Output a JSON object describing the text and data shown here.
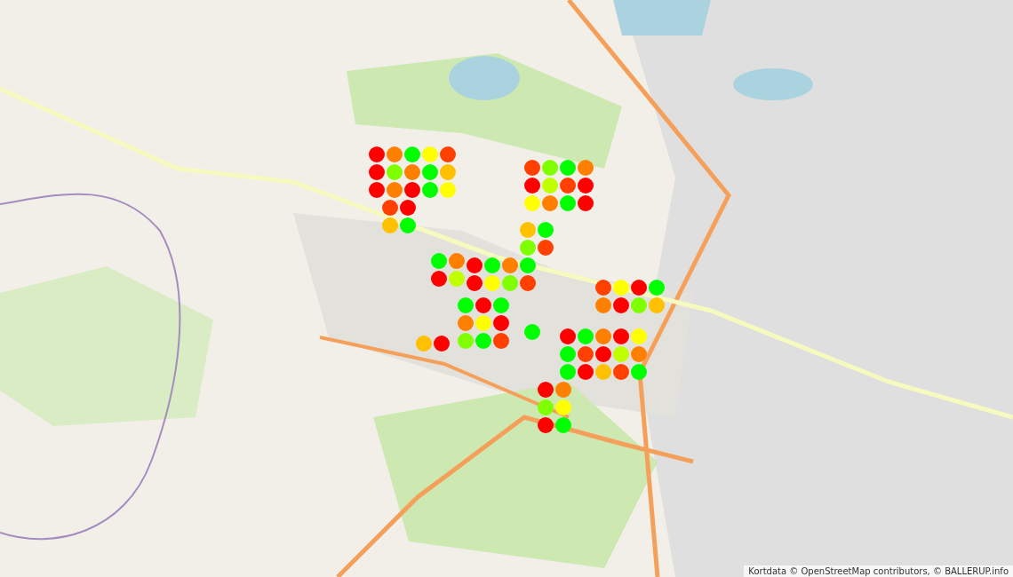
{
  "markers": [
    {
      "color": "#ff0000"
    },
    {
      "color": "#ff8000"
    },
    {
      "color": "#00ff00"
    },
    {
      "color": "#ffff00"
    },
    {
      "color": "#ff4000"
    },
    {
      "color": "#ff0000"
    },
    {
      "color": "#80ff00"
    },
    {
      "color": "#ff8000"
    },
    {
      "color": "#00ff00"
    },
    {
      "color": "#ffc000"
    },
    {
      "color": "#ff0000"
    },
    {
      "color": "#ff8000"
    },
    {
      "color": "#ff0000"
    },
    {
      "color": "#00ff00"
    },
    {
      "color": "#ffff00"
    },
    {
      "color": "#ff4000"
    },
    {
      "color": "#80ff00"
    },
    {
      "color": "#00ff00"
    },
    {
      "color": "#ff8000"
    },
    {
      "color": "#ff0000"
    },
    {
      "color": "#c0ff00"
    },
    {
      "color": "#ff4000"
    },
    {
      "color": "#ff0000"
    },
    {
      "color": "#ffff00"
    },
    {
      "color": "#ff8000"
    },
    {
      "color": "#00ff00"
    },
    {
      "color": "#ff0000"
    },
    {
      "color": "#ffc000"
    },
    {
      "color": "#00ff00"
    },
    {
      "color": "#80ff00"
    },
    {
      "color": "#ff4000"
    },
    {
      "color": "#ff0000"
    },
    {
      "color": "#00ff00"
    },
    {
      "color": "#ff8000"
    },
    {
      "color": "#00ff00"
    },
    {
      "color": "#ff0000"
    },
    {
      "color": "#ffff00"
    },
    {
      "color": "#80ff00"
    },
    {
      "color": "#ff4000"
    },
    {
      "color": "#00ff00"
    },
    {
      "color": "#ff8000"
    },
    {
      "color": "#ff0000"
    },
    {
      "color": "#c0ff00"
    },
    {
      "color": "#00ff00"
    },
    {
      "color": "#ff0000"
    },
    {
      "color": "#00ff00"
    },
    {
      "color": "#ff8000"
    },
    {
      "color": "#ffff00"
    },
    {
      "color": "#ff0000"
    },
    {
      "color": "#80ff00"
    },
    {
      "color": "#00ff00"
    },
    {
      "color": "#ff4000"
    },
    {
      "color": "#ffc000"
    },
    {
      "color": "#ff0000"
    },
    {
      "color": "#00ff00"
    },
    {
      "color": "#ff4000"
    },
    {
      "color": "#ffff00"
    },
    {
      "color": "#ff0000"
    },
    {
      "color": "#00ff00"
    },
    {
      "color": "#ff8000"
    },
    {
      "color": "#ff0000"
    },
    {
      "color": "#80ff00"
    },
    {
      "color": "#ffc000"
    },
    {
      "color": "#ff0000"
    },
    {
      "color": "#00ff00"
    },
    {
      "color": "#ff8000"
    },
    {
      "color": "#ff0000"
    },
    {
      "color": "#ffff00"
    },
    {
      "color": "#00ff00"
    },
    {
      "color": "#ff4000"
    },
    {
      "color": "#ff0000"
    },
    {
      "color": "#c0ff00"
    },
    {
      "color": "#ff8000"
    },
    {
      "color": "#00ff00"
    },
    {
      "color": "#ff0000"
    },
    {
      "color": "#ffc000"
    },
    {
      "color": "#ff4000"
    },
    {
      "color": "#00ff00"
    },
    {
      "color": "#ff0000"
    },
    {
      "color": "#ff8000"
    },
    {
      "color": "#80ff00"
    },
    {
      "color": "#ffff00"
    },
    {
      "color": "#ff0000"
    },
    {
      "color": "#00ff00"
    },
    {
      "color": "#ff4000"
    },
    {
      "color": "#ff0000"
    },
    {
      "color": "#ffc000"
    },
    {
      "color": "#00ff00"
    }
  ],
  "attribution": "Kortdata © OpenStreetMap contributors, © BALLERUP.info"
}
